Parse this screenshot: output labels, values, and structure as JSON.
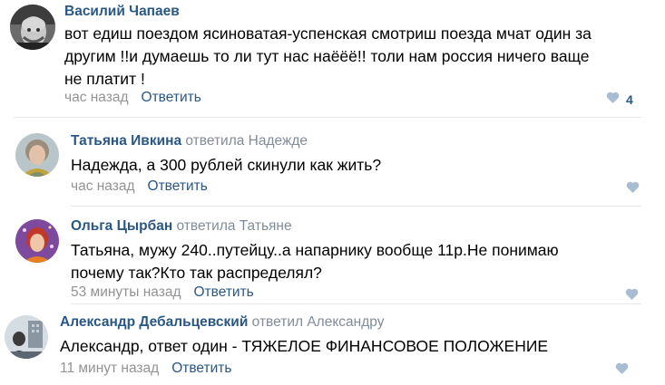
{
  "comments": [
    {
      "author": "Василий Чапаев",
      "replied_to": "",
      "text": "вот едиш поездом ясиноватая-успенская смотриш поезда мчат один за другим !!и думаешь то ли тут нас наёёё!! толи нам россия ничего ваще не платит !",
      "time": "час назад",
      "reply_label": "Ответить",
      "likes": "4"
    },
    {
      "author": "Татьяна Ивкина",
      "replied_to": "ответила Надежде",
      "text": "Надежда, а 300 рублей скинули как жить?",
      "time": "час назад",
      "reply_label": "Ответить",
      "likes": ""
    },
    {
      "author": "Ольга Цырбан",
      "replied_to": "ответила Татьяне",
      "text": "Татьяна, мужу 240..путейцу..а напарнику вообще 11р.Не понимаю почему так?Кто так распределял?",
      "time": "53 минуты назад",
      "reply_label": "Ответить",
      "likes": ""
    },
    {
      "author": "Александр Дебальцевский",
      "replied_to": "ответил Александру",
      "text": "Александр, ответ один - ТЯЖЕЛОЕ ФИНАНСОВОЕ ПОЛОЖЕНИЕ",
      "time": "11 минут назад",
      "reply_label": "Ответить",
      "likes": ""
    }
  ],
  "colors": {
    "link": "#2a5885",
    "muted": "#939393",
    "like_icon": "#a8bcd2",
    "divider": "#e7e8ec"
  },
  "icons": {
    "like": "heart-icon"
  }
}
